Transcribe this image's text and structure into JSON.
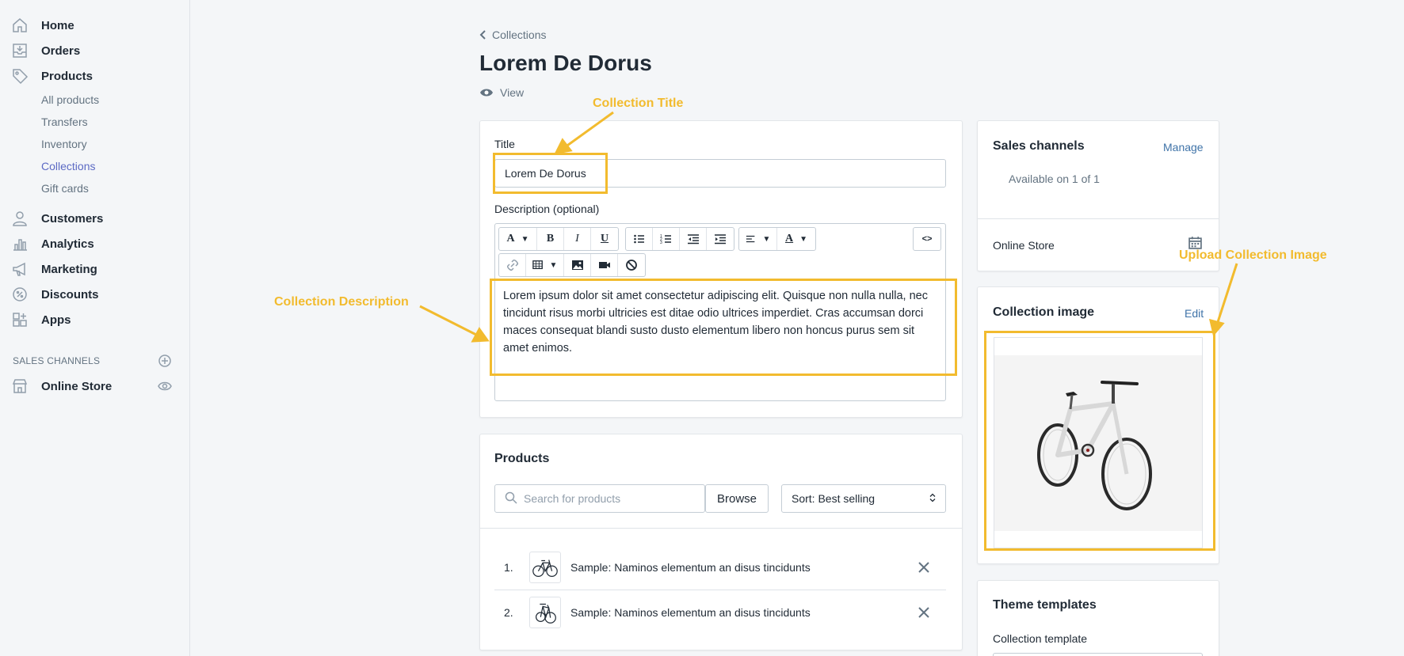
{
  "sidebar": {
    "items": [
      {
        "label": "Home",
        "icon": "home-icon"
      },
      {
        "label": "Orders",
        "icon": "orders-icon"
      },
      {
        "label": "Products",
        "icon": "tag-icon"
      },
      {
        "label": "Customers",
        "icon": "person-icon"
      },
      {
        "label": "Analytics",
        "icon": "bar-chart-icon"
      },
      {
        "label": "Marketing",
        "icon": "megaphone-icon"
      },
      {
        "label": "Discounts",
        "icon": "discount-icon"
      },
      {
        "label": "Apps",
        "icon": "apps-icon"
      }
    ],
    "product_sub_items": [
      "All products",
      "Transfers",
      "Inventory",
      "Collections",
      "Gift cards"
    ],
    "sales_channels_title": "SALES CHANNELS",
    "online_store": "Online Store"
  },
  "header": {
    "back_label": "Collections",
    "title": "Lorem De Dorus",
    "view_label": "View"
  },
  "collection_form": {
    "title_label": "Title",
    "title_value": "Lorem De Dorus",
    "description_label": "Description (optional)",
    "description_text": "Lorem ipsum dolor sit amet consectetur adipiscing elit. Quisque non nulla nulla, nec tincidunt risus morbi ultricies est ditae odio ultrices imperdiet. Cras accumsan dorci maces consequat blandi susto dusto elementum libero non honcus purus sem sit amet enimos.",
    "toolbar": {
      "font": "A",
      "bold": "B",
      "italic": "I",
      "underline": "U",
      "text_color": "A",
      "html": "<>"
    }
  },
  "products": {
    "title": "Products",
    "search_placeholder": "Search for products",
    "browse_label": "Browse",
    "sort_label": "Sort: Best selling",
    "rows": [
      {
        "num": "1.",
        "name": "Sample: Naminos elementum an disus tincidunts"
      },
      {
        "num": "2.",
        "name": "Sample: Naminos elementum an disus tincidunts"
      }
    ]
  },
  "sales_channels": {
    "title": "Sales channels",
    "manage_label": "Manage",
    "available": "Available on 1 of 1",
    "online_store": "Online Store"
  },
  "collection_image": {
    "title": "Collection image",
    "edit_label": "Edit"
  },
  "theme_templates": {
    "title": "Theme templates",
    "template_label": "Collection template"
  },
  "annotations": {
    "collection_title": "Collection Title",
    "collection_description": "Collection Description",
    "upload_image": "Upload Collection Image"
  },
  "colors": {
    "annotation": "#f2bb2e",
    "active_nav": "#5c6ac4",
    "link": "#3f73a8"
  }
}
